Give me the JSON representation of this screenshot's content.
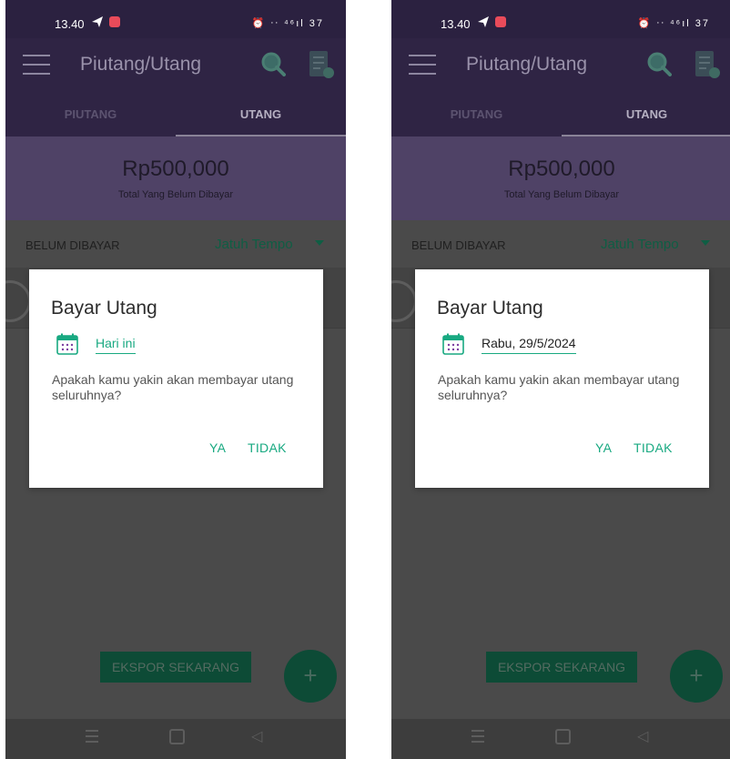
{
  "screens": [
    {
      "status_time": "13.40",
      "status_icons": "⏰ ᐧᐧ ⁴⁶ıl 37",
      "app_title": "Piutang/Utang",
      "tabs": [
        {
          "label": "PIUTANG"
        },
        {
          "label": "UTANG"
        }
      ],
      "active_tab": "UTANG",
      "summary": {
        "amount": "Rp500,000",
        "caption": "Total Yang Belum Dibayar"
      },
      "filter": {
        "status": "BELUM DIBAYAR",
        "sort": "Jatuh Tempo"
      },
      "export_label": "EKSPOR SEKARANG",
      "fab_label": "+",
      "dialog": {
        "title": "Bayar Utang",
        "date_value": "Hari ini",
        "message": "Apakah kamu yakin akan membayar utang seluruhnya?",
        "yes_label": "YA",
        "no_label": "TIDAK"
      }
    },
    {
      "status_time": "13.40",
      "status_icons": "⏰ ᐧᐧ ⁴⁶ıl 37",
      "app_title": "Piutang/Utang",
      "tabs": [
        {
          "label": "PIUTANG"
        },
        {
          "label": "UTANG"
        }
      ],
      "active_tab": "UTANG",
      "summary": {
        "amount": "Rp500,000",
        "caption": "Total Yang Belum Dibayar"
      },
      "filter": {
        "status": "BELUM DIBAYAR",
        "sort": "Jatuh Tempo"
      },
      "export_label": "EKSPOR SEKARANG",
      "fab_label": "+",
      "dialog": {
        "title": "Bayar Utang",
        "date_value": "Rabu, 29/5/2024",
        "message": "Apakah kamu yakin akan membayar utang seluruhnya?",
        "yes_label": "YA",
        "no_label": "TIDAK"
      }
    }
  ],
  "colors": {
    "status_bar": "#2b2140",
    "app_bar": "#2f2444",
    "summary_band": "#4f4266",
    "scrim": "#4a4a4a",
    "accent": "#18a981",
    "fab": "#0d4b36"
  },
  "icons": [
    "menu-icon",
    "search-icon",
    "report-icon",
    "calendar-icon",
    "add-icon",
    "nav-menu-icon",
    "nav-home-icon",
    "nav-back-icon"
  ]
}
